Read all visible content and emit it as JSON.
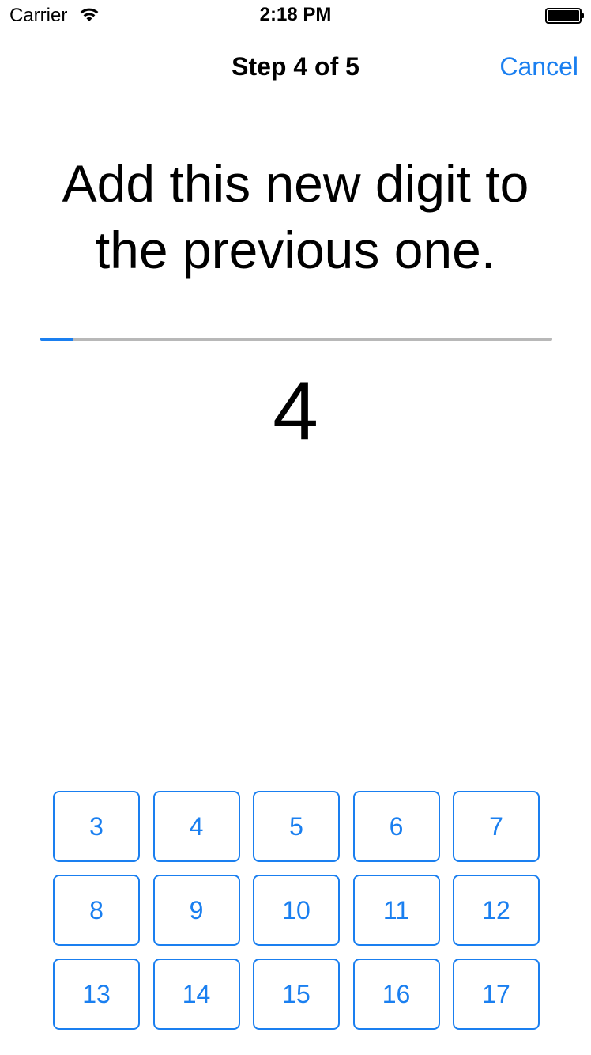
{
  "status_bar": {
    "carrier": "Carrier",
    "time": "2:18 PM",
    "wifi_icon": "wifi-icon",
    "battery_icon": "battery-icon"
  },
  "nav": {
    "title": "Step 4 of 5",
    "cancel_label": "Cancel"
  },
  "instruction": "Add this new digit to the previous one.",
  "progress": {
    "fraction": 0.065
  },
  "digit": "4",
  "answers": [
    "3",
    "4",
    "5",
    "6",
    "7",
    "8",
    "9",
    "10",
    "11",
    "12",
    "13",
    "14",
    "15",
    "16",
    "17"
  ],
  "colors": {
    "accent": "#1a7ff0",
    "track": "#b8b8b8",
    "text": "#000000",
    "background": "#ffffff"
  }
}
